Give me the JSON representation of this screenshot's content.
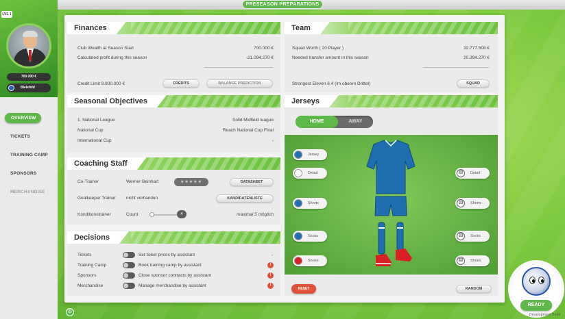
{
  "header": {
    "title": "PRESEASON PREPARATIONS"
  },
  "profile": {
    "level": "LVL 1",
    "money": "700.000 €",
    "club": "Bielefeld"
  },
  "nav": [
    {
      "label": "OVERVIEW",
      "state": "active"
    },
    {
      "label": "TICKETS",
      "state": "normal"
    },
    {
      "label": "TRAINING CAMP",
      "state": "normal"
    },
    {
      "label": "SPONSORS",
      "state": "normal"
    },
    {
      "label": "MERCHANDISE",
      "state": "disabled"
    }
  ],
  "finances": {
    "title": "Finances",
    "rows": [
      {
        "label": "Club Wealth at Season Start",
        "value": "700.000 €"
      },
      {
        "label": "Calculated profit during this season",
        "value": "-21.094.270 €"
      }
    ],
    "credit_limit": "Credit Limit 9.800.000 €",
    "credits_button": "CREDITS",
    "balance_button": "BALANCE PREDICTION"
  },
  "team": {
    "title": "Team",
    "rows": [
      {
        "label": "Squad Worth ( 20 Player )",
        "value": "32.777.508 €"
      },
      {
        "label": "Needed transfer amount in this season",
        "value": "20.394.270 €"
      }
    ],
    "strongest": "Strongest Eleven 6.4 (im oberen Drittel)",
    "squad_button": "SQUAD"
  },
  "objectives": {
    "title": "Seasonal Objectives",
    "rows": [
      {
        "label": "1. National League",
        "value": "Solid Midfield league"
      },
      {
        "label": "National Cup",
        "value": "Reach National Cup Final"
      },
      {
        "label": "International Cup",
        "value": "-"
      }
    ]
  },
  "coaching": {
    "title": "Coaching Staff",
    "co_trainer_label": "Co-Trainer",
    "co_trainer_name": "Werner Beinhart",
    "co_trainer_stars": "★★★★★",
    "datasheet_button": "DATASHEET",
    "gk_label": "Goalkeeper Trainer",
    "gk_value": "nicht vorhanden",
    "kandidaten_button": "KANDIDATENLISTE",
    "kondition_label": "Konditionstrainer",
    "count_label": "Count",
    "count_value": "4",
    "max_note": "maximal 5 möglich"
  },
  "decisions": {
    "title": "Decisions",
    "rows": [
      {
        "label": "Tickets",
        "text": "Set ticket prices by assistant",
        "warning": "-"
      },
      {
        "label": "Training Camp",
        "text": "Book training camp by assistant",
        "warning": "!"
      },
      {
        "label": "Sponsors",
        "text": "Close sponsor contracts by assistant",
        "warning": "!"
      },
      {
        "label": "Merchandise",
        "text": "Manage merchandise by assistant",
        "warning": "!"
      }
    ]
  },
  "jerseys": {
    "title": "Jerseys",
    "home_tab": "HOME",
    "away_tab": "AWAY",
    "jersey_label": "Jersey",
    "detail_label": "Detail",
    "shorts_label": "Shorts",
    "socks_label": "Socks",
    "shoes_label": "Shoes",
    "right_detail": "Detail",
    "right_shorts": "Shorts",
    "right_socks": "Socks",
    "right_shoes": "Shoes",
    "reset_button": "RESET",
    "random_button": "RANDOM",
    "colors": {
      "jersey": "#1f6fb0",
      "detail": "#ffffff",
      "shorts": "#1f6fb0",
      "socks": "#1f6fb0",
      "shoes": "#d81f26"
    }
  },
  "ready": {
    "label": "READY",
    "build": "Development Build"
  }
}
